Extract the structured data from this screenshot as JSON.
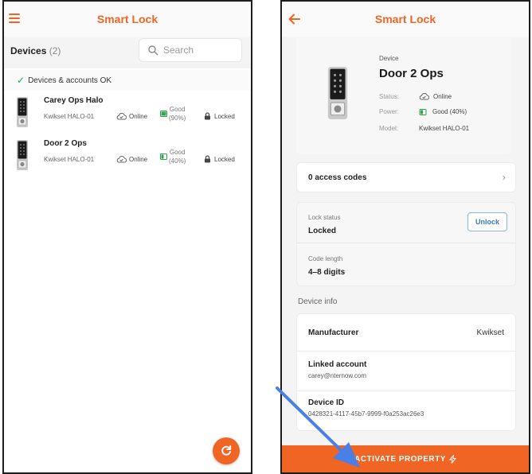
{
  "colors": {
    "accent": "#f06523",
    "online_green": "#2ea44f",
    "unlock_blue": "#3d7ab8"
  },
  "list_screen": {
    "title": "Smart Lock",
    "menu_icon": "hamburger-menu-icon",
    "devices_label": "Devices",
    "devices_count": "(2)",
    "search_placeholder": "Search",
    "status_text": "Devices & accounts OK",
    "devices": [
      {
        "name": "Carey Ops Halo",
        "model": "Kwikset HALO-01",
        "status": "Online",
        "battery_label": "Good",
        "battery_pct": "(90%)",
        "battery_level": 0.9,
        "lock_state": "Locked"
      },
      {
        "name": "Door 2 Ops",
        "model": "Kwikset HALO-01",
        "status": "Online",
        "battery_label": "Good",
        "battery_pct": "(40%)",
        "battery_level": 0.4,
        "lock_state": "Locked"
      }
    ],
    "refresh_icon": "refresh-icon"
  },
  "detail_screen": {
    "title": "Smart Lock",
    "back_icon": "back-arrow-icon",
    "device_caption": "Device",
    "device_name": "Door 2 Ops",
    "status_key": "Status:",
    "status_value": "Online",
    "power_key": "Power:",
    "power_value": "Good (40%)",
    "model_key": "Model:",
    "model_value": "Kwikset HALO-01",
    "access_codes": "0 access codes",
    "lock_status_caption": "Lock status",
    "lock_status_value": "Locked",
    "unlock_label": "Unlock",
    "code_length_caption": "Code length",
    "code_length_value": "4–8 digits",
    "device_info_label": "Device info",
    "manufacturer_key": "Manufacturer",
    "manufacturer_value": "Kwikset",
    "linked_account_key": "Linked account",
    "linked_account_value": "carey@nternow.com",
    "device_id_key": "Device ID",
    "device_id_value": "0428321-4117-45b7-9999-f0a253ac26e3",
    "activate_label": "ACTIVATE PROPERTY"
  }
}
